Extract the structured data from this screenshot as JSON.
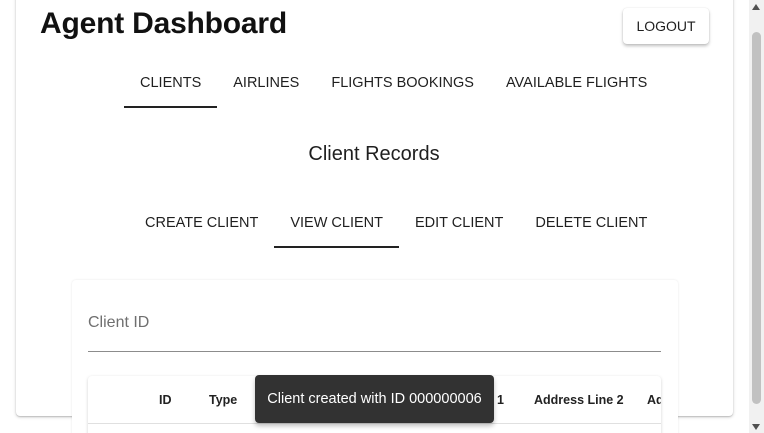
{
  "header": {
    "title": "Agent Dashboard",
    "logout_label": "LOGOUT"
  },
  "main_tabs": [
    {
      "label": "CLIENTS",
      "active": true
    },
    {
      "label": "AIRLINES",
      "active": false
    },
    {
      "label": "FLIGHTS BOOKINGS",
      "active": false
    },
    {
      "label": "AVAILABLE FLIGHTS",
      "active": false
    }
  ],
  "section": {
    "title": "Client Records"
  },
  "sub_tabs": [
    {
      "label": "CREATE CLIENT",
      "active": false
    },
    {
      "label": "VIEW CLIENT",
      "active": true
    },
    {
      "label": "EDIT CLIENT",
      "active": false
    },
    {
      "label": "DELETE CLIENT",
      "active": false
    }
  ],
  "client_id_field": {
    "label": "Client ID"
  },
  "table": {
    "columns": [
      "ID",
      "Type",
      "1",
      "Address Line 2",
      "Ad"
    ]
  },
  "snackbar": {
    "message": "Client created with ID 000000006"
  },
  "colors": {
    "snackbar_bg": "#323232",
    "active_indicator": "#222222"
  }
}
